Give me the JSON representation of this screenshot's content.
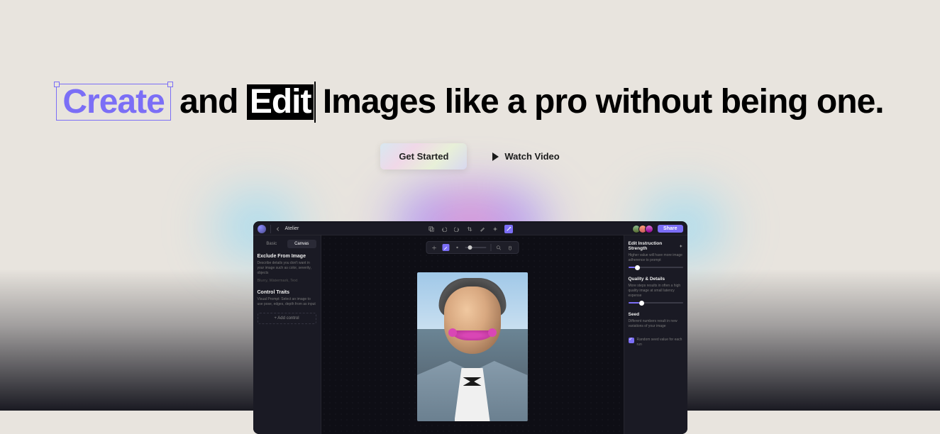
{
  "hero": {
    "word_create": "Create",
    "word_and": " and ",
    "word_edit": "Edit",
    "rest": " Images like a pro without being one.",
    "cta_primary": "Get Started",
    "cta_video": "Watch Video"
  },
  "app": {
    "breadcrumb": "Atelier",
    "share": "Share",
    "toolbar_icons": [
      "layers-icon",
      "undo-icon",
      "redo-icon",
      "crop-icon",
      "brush-icon",
      "sparkle-icon",
      "wand-icon"
    ],
    "left": {
      "tabs": [
        "Basic",
        "Canvas"
      ],
      "active_tab": 1,
      "sections": [
        {
          "title": "Exclude From Image",
          "desc": "Describe details you don't want in your image such as color, severity, objects",
          "placeholder": "Blurry, Watermark, Text"
        },
        {
          "title": "Control Traits",
          "desc": "Visual Prompt: Select an image to use pose, edges, depth from as input"
        }
      ],
      "add_control": "+ Add control"
    },
    "right": {
      "sections": [
        {
          "title": "Edit Instruction Strength",
          "desc": "Higher value will have more image adherence to prompt",
          "slider": 12
        },
        {
          "title": "Quality & Details",
          "desc": "More steps results in often a high quality image at small latency expense",
          "slider": 20
        },
        {
          "title": "Seed",
          "desc": "Different numbers result in new variations of your image"
        }
      ],
      "checkbox_label": "Random seed value for each run"
    }
  }
}
